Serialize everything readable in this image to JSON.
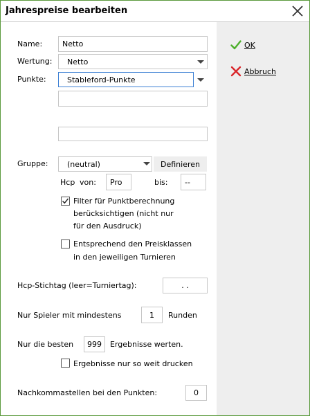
{
  "window": {
    "title": "Jahrespreise bearbeiten"
  },
  "actions": {
    "ok": "OK",
    "cancel": "Abbruch"
  },
  "form": {
    "name_label": "Name:",
    "name_value": "Netto",
    "wertung_label": "Wertung:",
    "wertung_value": "Netto",
    "punkte_label": "Punkte:",
    "punkte_value": "Stableford-Punkte",
    "gruppe_label": "Gruppe:",
    "gruppe_value": "(neutral)",
    "definieren": "Definieren",
    "hcp_label": "Hcp",
    "von_label": "von:",
    "von_value": "Pro",
    "bis_label": "bis:",
    "bis_value": "--",
    "filter_line1": "Filter für Punktberechnung",
    "filter_line2": "berücksichtigen (nicht nur",
    "filter_line3": "für den Ausdruck)",
    "filter_checked": true,
    "preisklassen_line1": "Entsprechend den Preisklassen",
    "preisklassen_line2": "in den jeweiligen Turnieren",
    "preisklassen_checked": false,
    "stichtag_label": "Hcp-Stichtag (leer=Turniertag):",
    "stichtag_value": ". .",
    "nur_spieler_label": "Nur Spieler mit mindestens",
    "runden_value": "1",
    "runden_label": "Runden",
    "nur_besten_label": "Nur die besten",
    "besten_value": "999",
    "ergebnisse_werten": "Ergebnisse werten.",
    "drucken_label": "Ergebnisse nur so weit drucken",
    "drucken_checked": false,
    "nachkomma_label": "Nachkommastellen bei den Punkten:",
    "nachkomma_value": "0"
  },
  "colors": {
    "ok_check": "#4caf2a",
    "cancel_x": "#d9252a",
    "frame": "#5a9a3c",
    "panel": "#eeeeee"
  }
}
